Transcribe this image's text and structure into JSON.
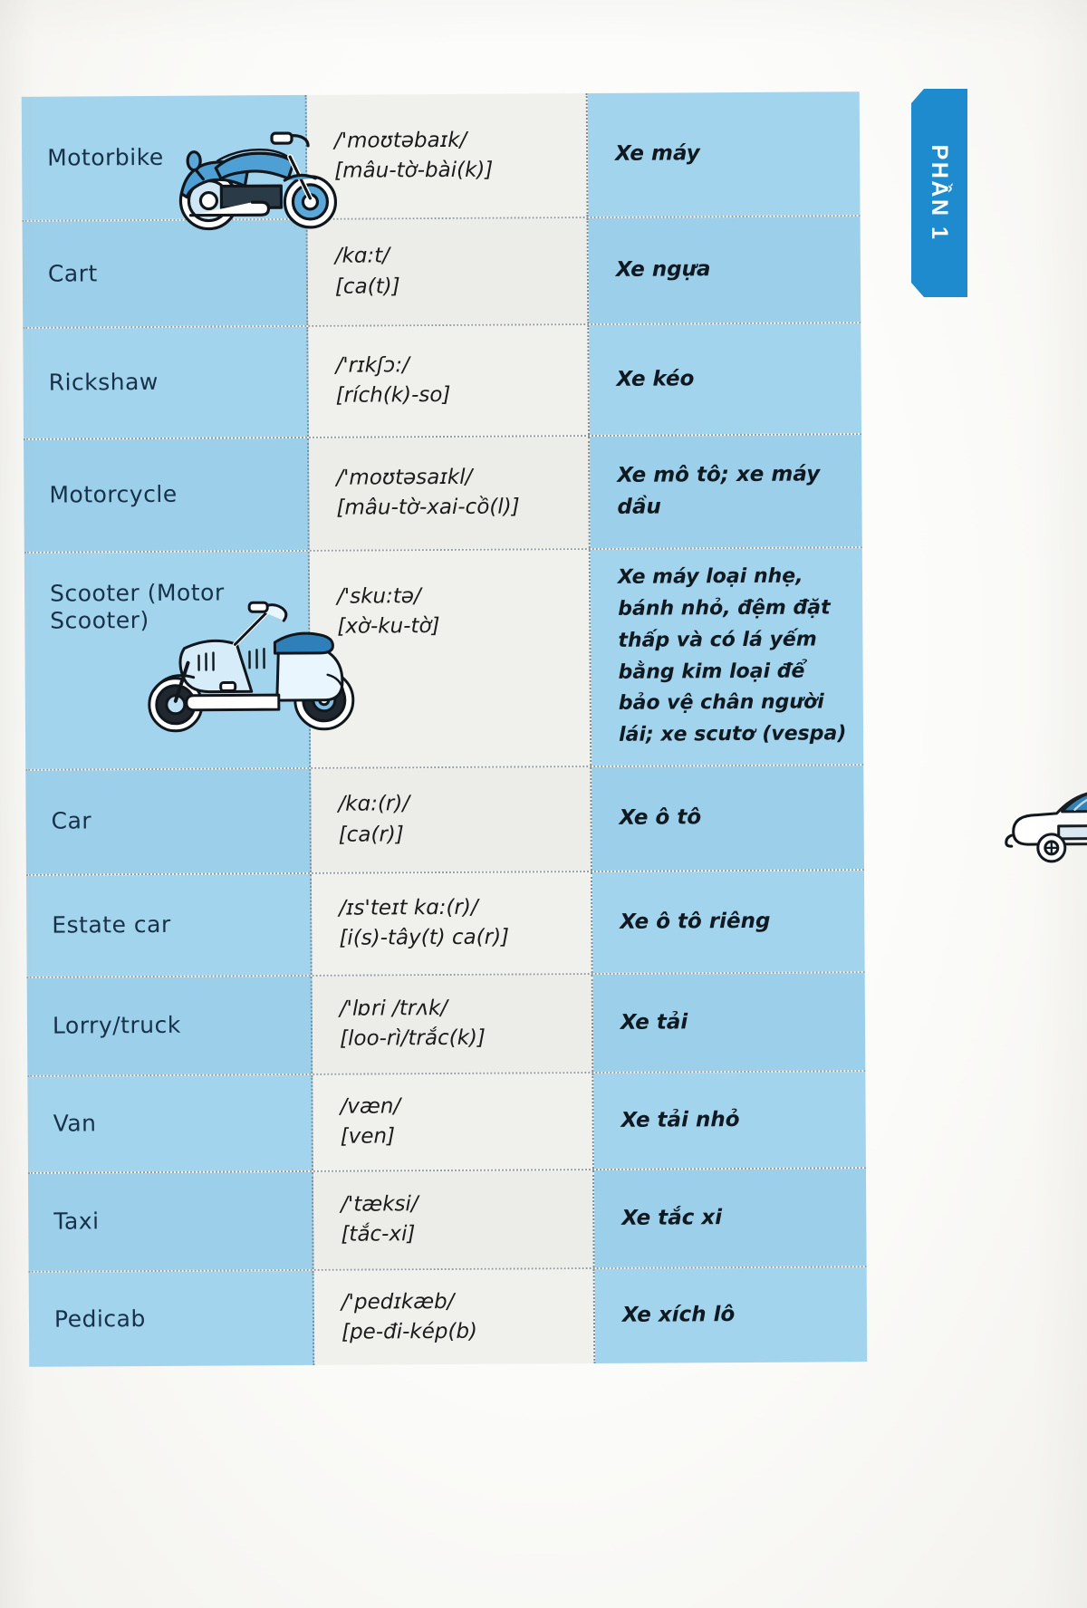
{
  "side_tab": {
    "label": "PHẦN 1",
    "color": "#1e8bce"
  },
  "colors": {
    "term_column_bg": "#9fd2ec",
    "phonetic_column_bg": "#efefeb",
    "meaning_column_bg": "#9fd2ec",
    "text": "#17314a",
    "accent": "#1e8bce"
  },
  "table": {
    "rows": [
      {
        "term": "Motorbike",
        "ipa": "/'moʊtəbaɪk/",
        "viet_phonetic": "[mâu-tờ-bài(k)]",
        "meaning": "Xe máy",
        "illustration": "motorbike-illustration"
      },
      {
        "term": "Cart",
        "ipa": "/kɑ:t/",
        "viet_phonetic": "[ca(t)]",
        "meaning": "Xe ngựa",
        "illustration": null
      },
      {
        "term": "Rickshaw",
        "ipa": "/'rɪkʃɔ:/",
        "viet_phonetic": "[rích(k)-so]",
        "meaning": "Xe kéo",
        "illustration": null
      },
      {
        "term": "Motorcycle",
        "ipa": "/'moʊtəsaɪkl/",
        "viet_phonetic": "[mâu-tờ-xai-cồ(l)]",
        "meaning": "Xe mô tô; xe máy dầu",
        "illustration": null
      },
      {
        "term": "Scooter (Motor Scooter)",
        "ipa": "/'sku:tə/",
        "viet_phonetic": "[xờ-ku-tờ]",
        "meaning": "Xe máy loại nhẹ, bánh nhỏ, đệm đặt thấp và có lá yếm bằng kim loại để bảo vệ chân người lái; xe scutơ (vespa)",
        "illustration": "scooter-illustration"
      },
      {
        "term": "Car",
        "ipa": "/kɑ:(r)/",
        "viet_phonetic": "[ca(r)]",
        "meaning": "Xe ô tô",
        "illustration": "car-illustration"
      },
      {
        "term": "Estate car",
        "ipa": "/ɪs'teɪt kɑ:(r)/",
        "viet_phonetic": "[i(s)-tây(t) ca(r)]",
        "meaning": "Xe ô tô riêng",
        "illustration": null
      },
      {
        "term": "Lorry/truck",
        "ipa": "/'lɒri /trʌk/",
        "viet_phonetic": "[loo-rì/trắc(k)]",
        "meaning": "Xe tải",
        "illustration": null
      },
      {
        "term": "Van",
        "ipa": "/væn/",
        "viet_phonetic": "[ven]",
        "meaning": "Xe tải nhỏ",
        "illustration": null
      },
      {
        "term": "Taxi",
        "ipa": "/'tæksi/",
        "viet_phonetic": "[tắc-xi]",
        "meaning": "Xe tắc xi",
        "illustration": null
      },
      {
        "term": "Pedicab",
        "ipa": "/'pedɪkæb/",
        "viet_phonetic": "[pe-đi-kép(b)",
        "meaning": "Xe xích lô",
        "illustration": null
      }
    ]
  }
}
